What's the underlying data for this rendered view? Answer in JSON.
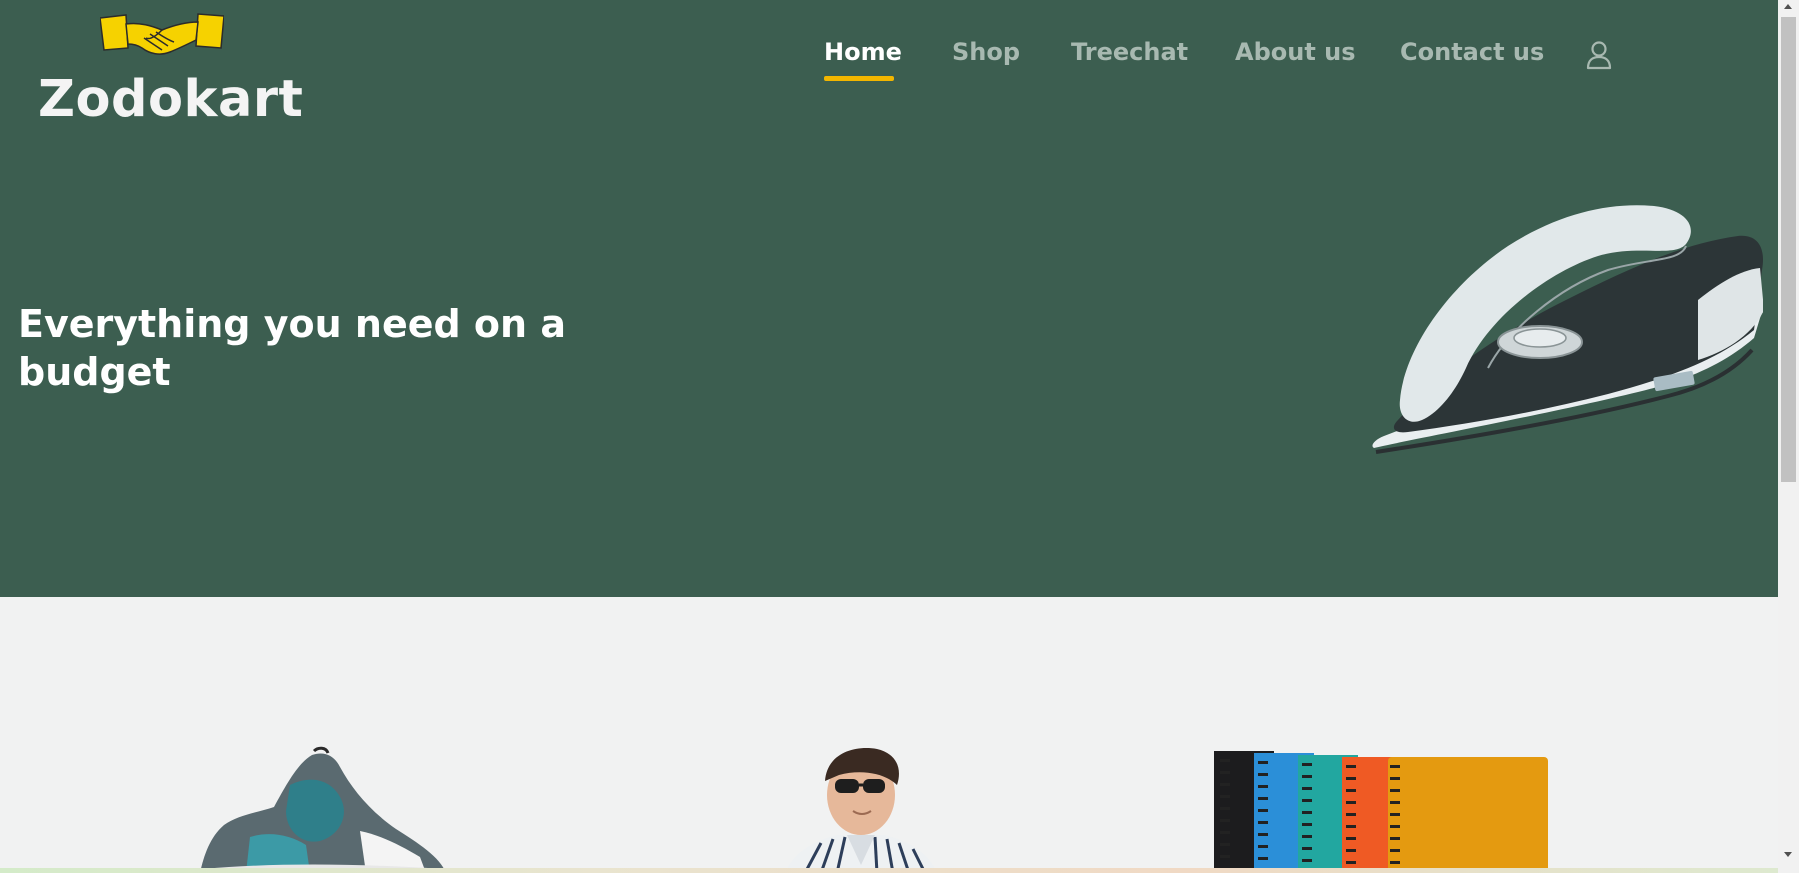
{
  "app": {
    "brand_name": "Zodokart",
    "logo_icon": "handshake-icon"
  },
  "nav": {
    "items": [
      {
        "label": "Home",
        "active": true
      },
      {
        "label": "Shop",
        "active": false
      },
      {
        "label": "Treechat",
        "active": false
      },
      {
        "label": "About us",
        "active": false
      },
      {
        "label": "Contact us",
        "active": false
      }
    ],
    "user_icon": "user-icon"
  },
  "hero": {
    "headline": "Everything you need on a budget",
    "image": "iron-product-image"
  },
  "products": [
    {
      "image": "sneaker-product-image"
    },
    {
      "image": "shirt-model-product-image"
    },
    {
      "image": "notebooks-product-image"
    }
  ],
  "colors": {
    "hero_bg": "#3c5e50",
    "accent": "#f3b600",
    "nav_inactive": "#a8b9b1",
    "page_bg": "#f1f2f2"
  }
}
